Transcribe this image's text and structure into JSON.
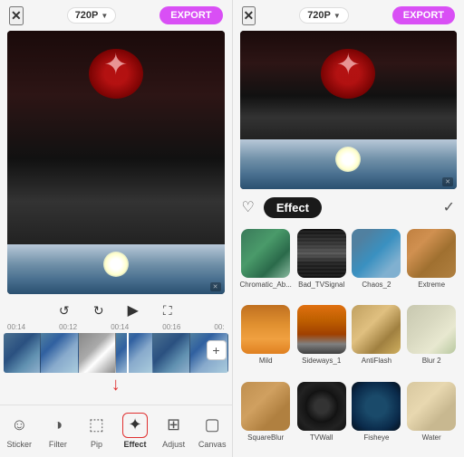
{
  "left": {
    "close_label": "✕",
    "resolution": "720P",
    "resolution_arrow": "▼",
    "export_label": "EXPORT",
    "timestamps": [
      "00:14",
      "00:12",
      "00:14",
      "00:16",
      "00:"
    ],
    "add_clip": "+",
    "controls": {
      "undo": "↺",
      "redo": "↻",
      "play": "▶",
      "fullscreen": "⛶"
    },
    "watermark": "✕",
    "nav_items": [
      {
        "id": "sticker",
        "label": "Sticker",
        "icon": "☺"
      },
      {
        "id": "filter",
        "label": "Filter",
        "icon": "◑"
      },
      {
        "id": "pip",
        "label": "Pip",
        "icon": "⬚"
      },
      {
        "id": "effect",
        "label": "Effect",
        "icon": "✦",
        "active": true
      },
      {
        "id": "adjust",
        "label": "Adjust",
        "icon": "⊞"
      },
      {
        "id": "canvas",
        "label": "Canvas",
        "icon": "▢"
      }
    ]
  },
  "right": {
    "close_label": "✕",
    "resolution": "720P",
    "resolution_arrow": "▼",
    "export_label": "EXPORT",
    "effect_panel": {
      "heart_icon": "♡",
      "title": "Effect",
      "checkmark": "✓"
    },
    "effects": [
      {
        "id": "chromatic_ab",
        "label": "Chromatic_Ab...",
        "class": "eff-chromatic"
      },
      {
        "id": "bad_tv_signal",
        "label": "Bad_TVSignal",
        "class": "eff-bad-tv"
      },
      {
        "id": "chaos_2",
        "label": "Chaos_2",
        "class": "eff-chaos"
      },
      {
        "id": "extreme",
        "label": "Extreme",
        "class": "eff-extreme"
      },
      {
        "id": "mild",
        "label": "Mild",
        "class": "eff-mild"
      },
      {
        "id": "sideways_1",
        "label": "Sideways_1",
        "class": "eff-sideways"
      },
      {
        "id": "antiflash",
        "label": "AntiFlash",
        "class": "eff-antiflash"
      },
      {
        "id": "blur_2",
        "label": "Blur 2",
        "class": "eff-blur"
      },
      {
        "id": "square_blur",
        "label": "SquareBlur",
        "class": "eff-squareblur"
      },
      {
        "id": "tvwall",
        "label": "TVWall",
        "class": "eff-tvwall"
      },
      {
        "id": "fisheye",
        "label": "Fisheye",
        "class": "eff-fisheye"
      },
      {
        "id": "water",
        "label": "Water",
        "class": "eff-water"
      }
    ]
  }
}
